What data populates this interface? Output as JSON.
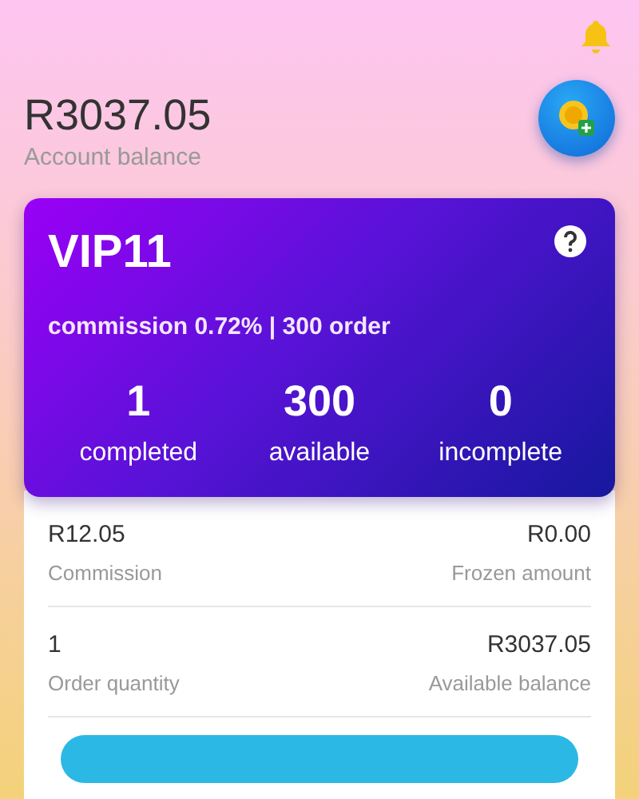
{
  "balance": {
    "amount": "R3037.05",
    "label": "Account balance"
  },
  "vip_card": {
    "level": "VIP11",
    "summary": "commission 0.72% | 300 order",
    "stats": [
      {
        "value": "1",
        "label": "completed"
      },
      {
        "value": "300",
        "label": "available"
      },
      {
        "value": "0",
        "label": "incomplete"
      }
    ]
  },
  "details": [
    {
      "left": {
        "value": "R12.05",
        "label": "Commission"
      },
      "right": {
        "value": "R0.00",
        "label": "Frozen amount"
      }
    },
    {
      "left": {
        "value": "1",
        "label": "Order quantity"
      },
      "right": {
        "value": "R3037.05",
        "label": "Available balance"
      }
    }
  ]
}
